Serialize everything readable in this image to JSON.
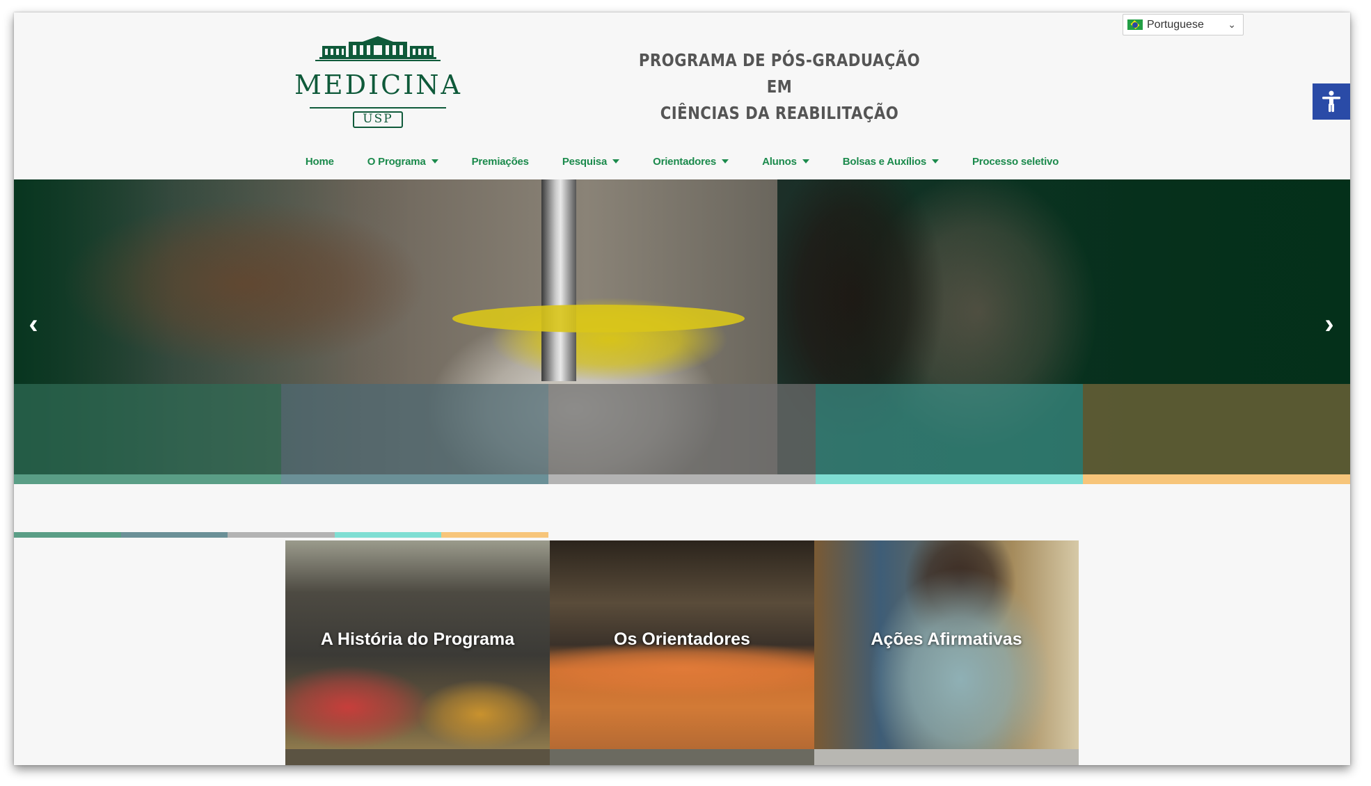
{
  "header": {
    "logo_word": "MEDICINA",
    "logo_sub": "USP",
    "title_line1": "PROGRAMA DE PÓS-GRADUAÇÃO EM",
    "title_line2": "CIÊNCIAS DA REABILITAÇÃO"
  },
  "language": {
    "selected": "Portuguese",
    "flag_icon": "brazil-flag-icon"
  },
  "accessibility": {
    "icon": "accessibility-person-icon",
    "libras_icon": "sign-language-hands-icon"
  },
  "nav": {
    "items": [
      {
        "label": "Home",
        "dropdown": false
      },
      {
        "label": "O Programa",
        "dropdown": true
      },
      {
        "label": "Premiações",
        "dropdown": false
      },
      {
        "label": "Pesquisa",
        "dropdown": true
      },
      {
        "label": "Orientadores",
        "dropdown": true
      },
      {
        "label": "Alunos",
        "dropdown": true
      },
      {
        "label": "Bolsas e Auxílios",
        "dropdown": true
      },
      {
        "label": "Processo seletivo",
        "dropdown": false
      }
    ]
  },
  "hero": {
    "prev_icon": "chevron-left-icon",
    "next_icon": "chevron-right-icon",
    "band_colors": [
      "#2f6b55",
      "#4d6a73",
      "#6f6f6f",
      "#3c8f87",
      "#7a6a3c"
    ],
    "strip_colors": [
      "#5a9e86",
      "#6b9097",
      "#b3b3b3",
      "#7fded3",
      "#f7c57a"
    ]
  },
  "cards": {
    "strip_colors": [
      "#5a9e86",
      "#6b9097",
      "#b3b3b3",
      "#7fded3",
      "#f7c57a"
    ],
    "items": [
      {
        "title": "A História do Programa"
      },
      {
        "title": "Os Orientadores"
      },
      {
        "title": "Ações Afirmativas"
      }
    ]
  }
}
